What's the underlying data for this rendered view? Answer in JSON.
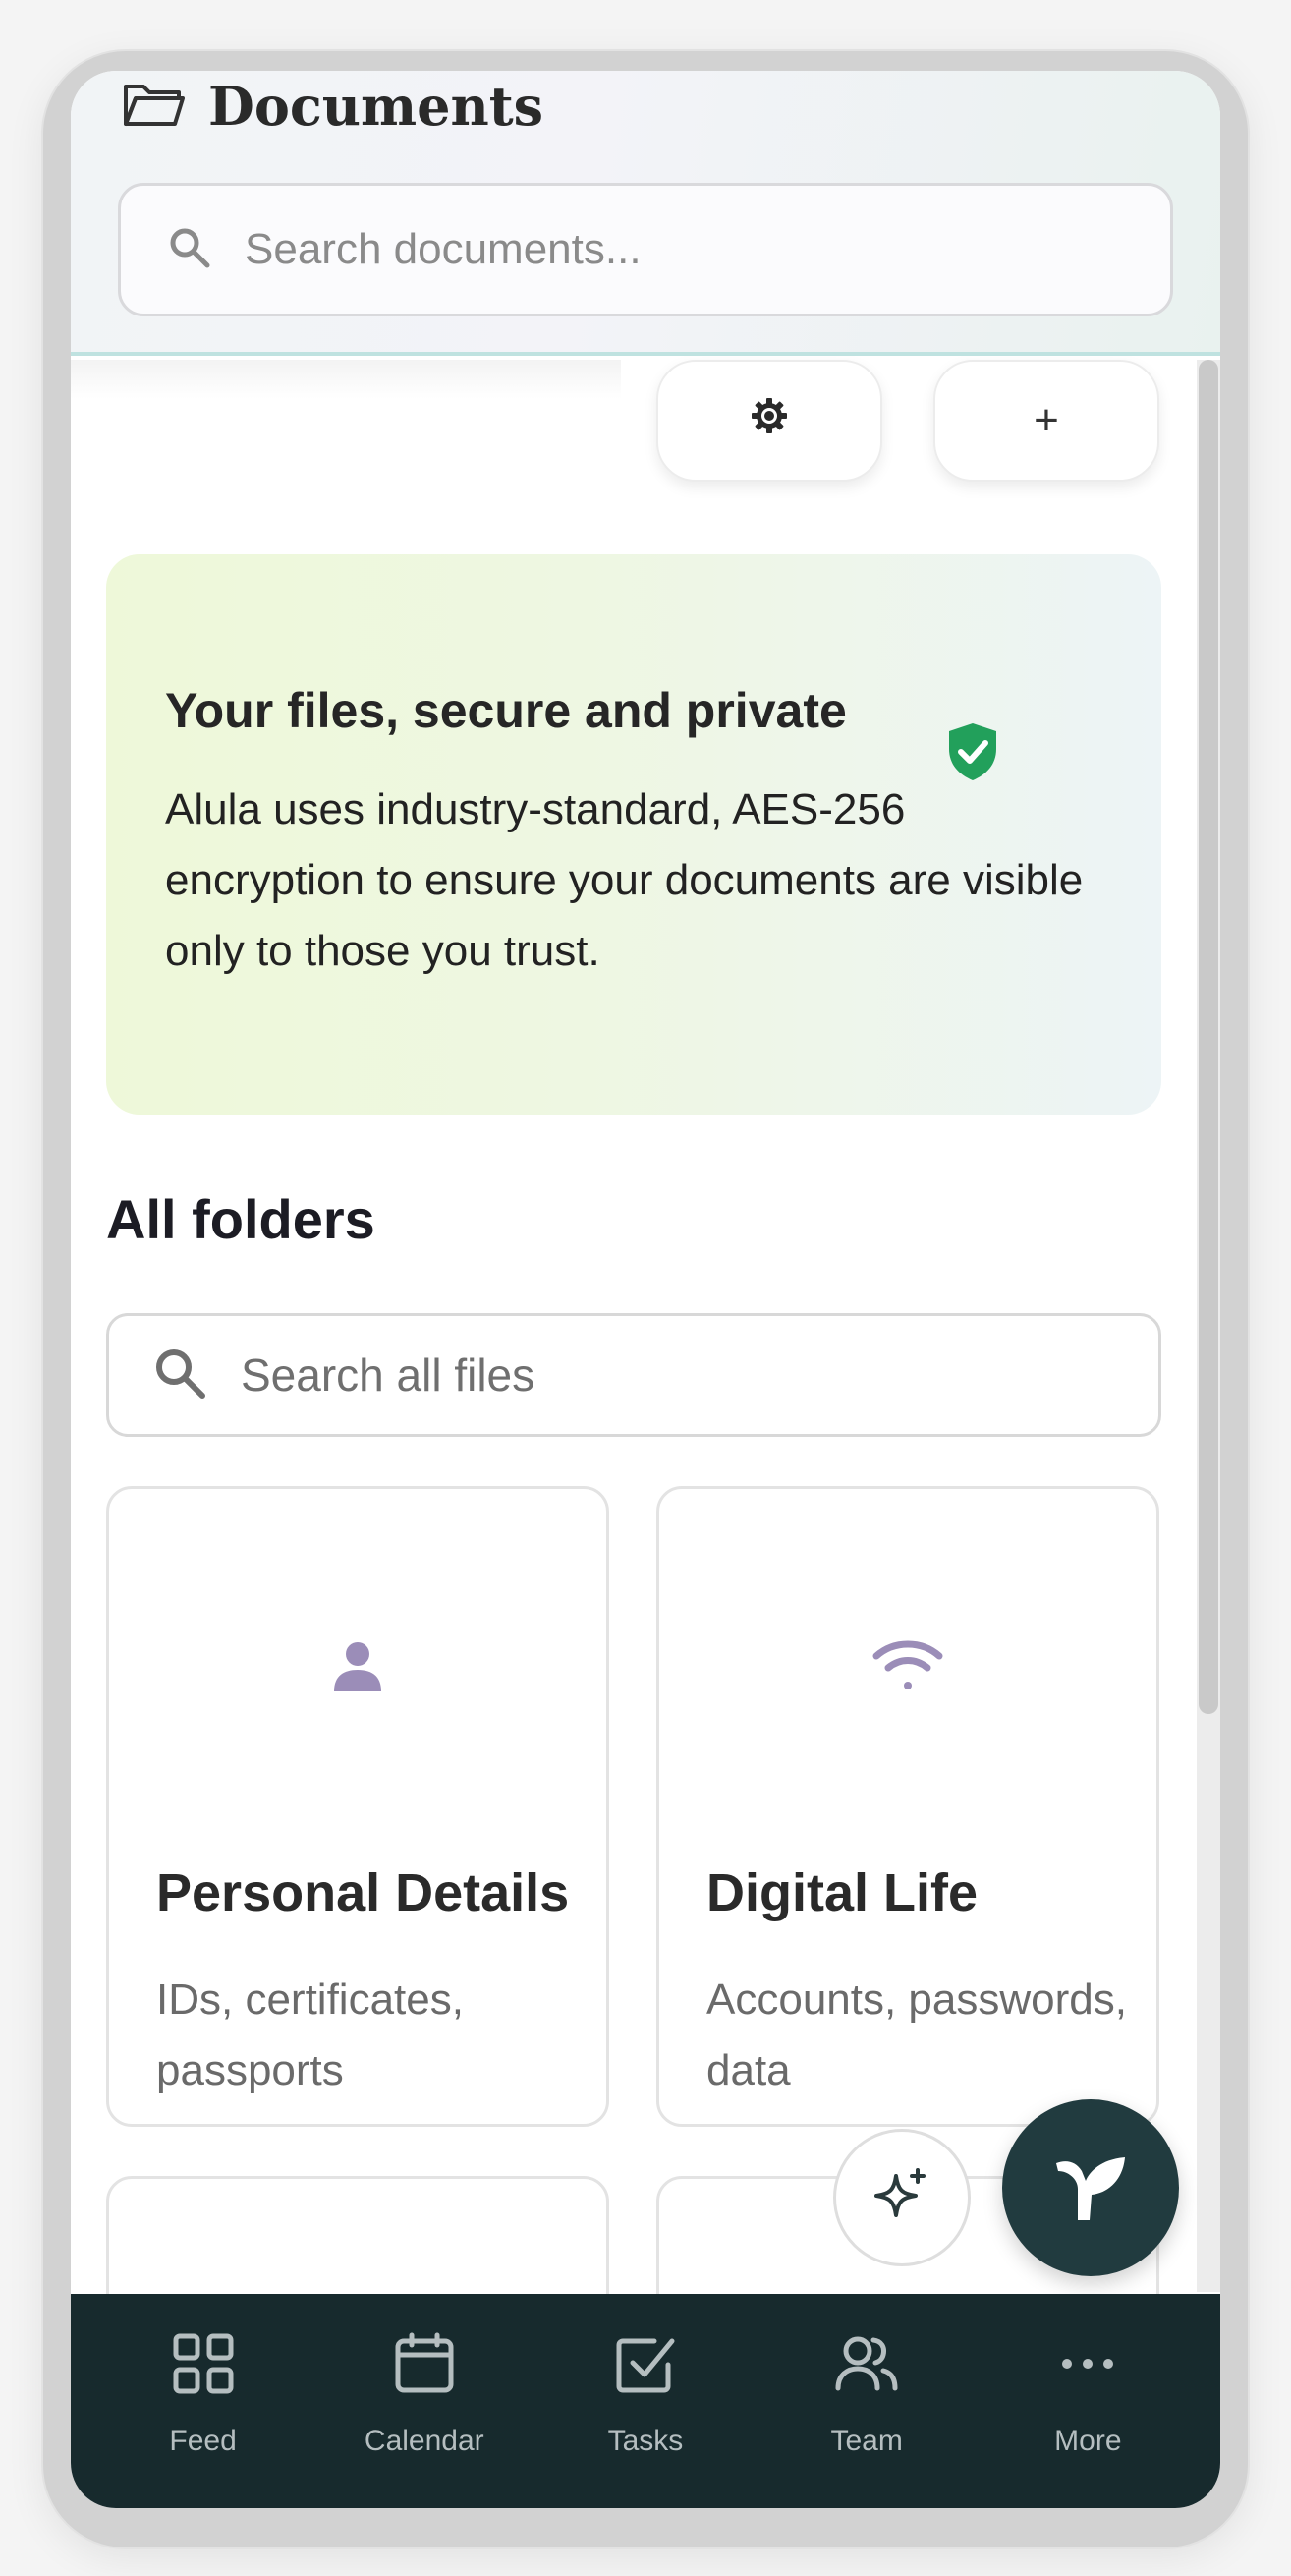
{
  "header": {
    "title": "Documents",
    "search_placeholder": "Search documents..."
  },
  "toolbar": {
    "add_label": "+"
  },
  "security_card": {
    "title": "Your files, secure and private",
    "body": "Alula uses industry-standard, AES-256 encryption to ensure your documents are visible only to those you trust.",
    "icon": "shield-check-icon",
    "icon_color": "#22a05b"
  },
  "folders_section": {
    "title": "All folders",
    "search_placeholder": "Search all files",
    "folders": [
      {
        "title": "Personal Details",
        "description": "IDs, certificates, passports",
        "icon": "person-icon"
      },
      {
        "title": "Digital Life",
        "description": "Accounts, passwords, data",
        "icon": "wifi-icon"
      }
    ]
  },
  "bottom_nav": {
    "items": [
      {
        "label": "Feed",
        "icon": "grid-icon"
      },
      {
        "label": "Calendar",
        "icon": "calendar-icon"
      },
      {
        "label": "Tasks",
        "icon": "checkbox-icon"
      },
      {
        "label": "Team",
        "icon": "users-icon"
      },
      {
        "label": "More",
        "icon": "more-dots-icon"
      }
    ]
  },
  "colors": {
    "accent_purple": "#9b8db8",
    "nav_background": "#172a2d",
    "fab_background": "#213b3f"
  }
}
